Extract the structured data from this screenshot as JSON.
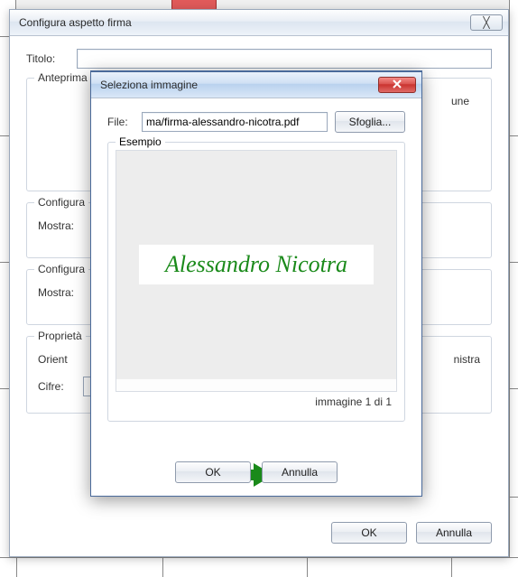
{
  "bg": {
    "ticks": [
      "10 70",
      "10 54",
      "580 00",
      "560 70"
    ]
  },
  "parent": {
    "title": "Configura aspetto firma",
    "titolo_label": "Titolo:",
    "titolo_value": "",
    "anteprima_legend": "Anteprima",
    "right_trunc": "une",
    "configura1_legend": "Configura",
    "mostra1_label": "Mostra:",
    "configura2_legend": "Configura",
    "mostra2_label": "Mostra:",
    "proprieta_legend": "Proprietà",
    "orient_label": "Orient",
    "nistra_label": "nistra",
    "cifre_label": "Cifre:",
    "ok": "OK",
    "cancel": "Annulla"
  },
  "modal": {
    "title": "Seleziona immagine",
    "file_label": "File:",
    "file_value": "ma/firma-alessandro-nicotra.pdf",
    "browse": "Sfoglia...",
    "example_legend": "Esempio",
    "signature_text": "Alessandro Nicotra",
    "page_indicator": "immagine 1 di 1",
    "ok": "OK",
    "cancel": "Annulla"
  }
}
